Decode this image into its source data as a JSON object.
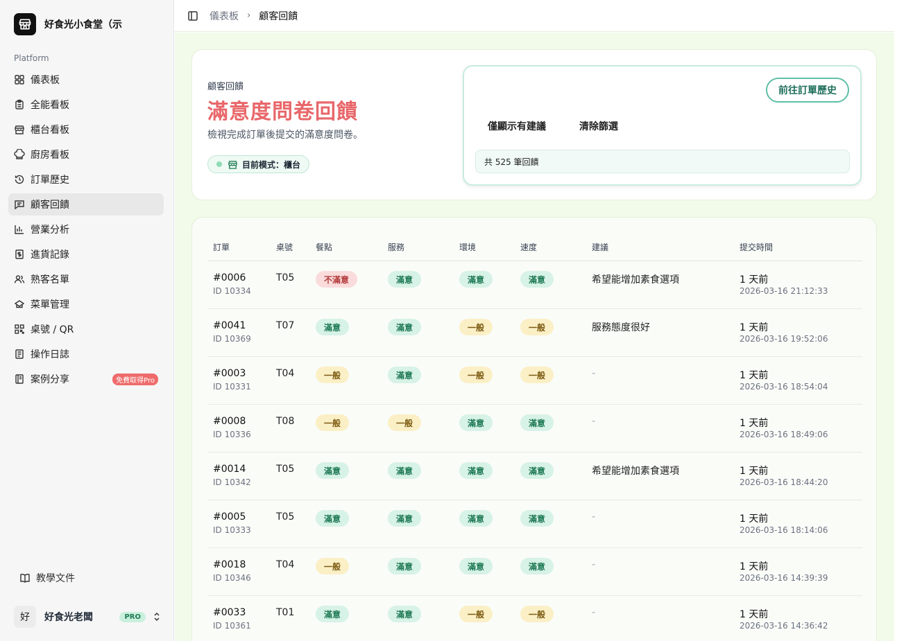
{
  "brand": {
    "name": "好食光小食堂（示"
  },
  "sidebar": {
    "group_label": "Platform",
    "items": [
      {
        "label": "儀表板",
        "icon": "grid-icon"
      },
      {
        "label": "全能看板",
        "icon": "clipboard-icon"
      },
      {
        "label": "櫃台看板",
        "icon": "store-icon"
      },
      {
        "label": "廚房看板",
        "icon": "chef-hat-icon"
      },
      {
        "label": "訂單歷史",
        "icon": "history-icon"
      },
      {
        "label": "顧客回饋",
        "icon": "message-icon",
        "active": true
      },
      {
        "label": "營業分析",
        "icon": "bar-chart-icon"
      },
      {
        "label": "進貨記錄",
        "icon": "receipt-icon"
      },
      {
        "label": "熟客名單",
        "icon": "users-icon"
      },
      {
        "label": "菜單管理",
        "icon": "menu-icon"
      },
      {
        "label": "桌號 / QR",
        "icon": "qr-icon"
      },
      {
        "label": "操作日誌",
        "icon": "log-icon"
      },
      {
        "label": "案例分享",
        "icon": "book-icon",
        "tag": "免費取得Pro"
      }
    ],
    "docs_label": "教學文件",
    "user": {
      "avatar": "好",
      "name": "好食光老闆",
      "badge": "PRO"
    }
  },
  "breadcrumb": {
    "parent": "儀表板",
    "current": "顧客回饋"
  },
  "hero": {
    "kicker": "顧客回饋",
    "title": "滿意度問卷回饋",
    "description": "檢視完成訂單後提交的滿意度問卷。",
    "mode": "目前模式：櫃台"
  },
  "filters": {
    "go_button": "前往訂單歷史",
    "only_suggestions": "僅顯示有建議",
    "clear": "清除篩選",
    "count_text": "共 525 筆回饋"
  },
  "table": {
    "headers": [
      "訂單",
      "桌號",
      "餐點",
      "服務",
      "環境",
      "速度",
      "建議",
      "提交時間"
    ],
    "rows": [
      {
        "order": "#0006",
        "id": "ID 10334",
        "table": "T05",
        "food": "不滿意",
        "service": "滿意",
        "env": "滿意",
        "speed": "滿意",
        "suggestion": "希望能增加素食選項",
        "ago": "1 天前",
        "time": "2026-03-16 21:12:33"
      },
      {
        "order": "#0041",
        "id": "ID 10369",
        "table": "T07",
        "food": "滿意",
        "service": "滿意",
        "env": "一般",
        "speed": "一般",
        "suggestion": "服務態度很好",
        "ago": "1 天前",
        "time": "2026-03-16 19:52:06"
      },
      {
        "order": "#0003",
        "id": "ID 10331",
        "table": "T04",
        "food": "一般",
        "service": "滿意",
        "env": "一般",
        "speed": "一般",
        "suggestion": "-",
        "ago": "1 天前",
        "time": "2026-03-16 18:54:04"
      },
      {
        "order": "#0008",
        "id": "ID 10336",
        "table": "T08",
        "food": "一般",
        "service": "一般",
        "env": "滿意",
        "speed": "滿意",
        "suggestion": "-",
        "ago": "1 天前",
        "time": "2026-03-16 18:49:06"
      },
      {
        "order": "#0014",
        "id": "ID 10342",
        "table": "T05",
        "food": "滿意",
        "service": "滿意",
        "env": "滿意",
        "speed": "滿意",
        "suggestion": "希望能增加素食選項",
        "ago": "1 天前",
        "time": "2026-03-16 18:44:20"
      },
      {
        "order": "#0005",
        "id": "ID 10333",
        "table": "T05",
        "food": "滿意",
        "service": "滿意",
        "env": "滿意",
        "speed": "滿意",
        "suggestion": "-",
        "ago": "1 天前",
        "time": "2026-03-16 18:14:06"
      },
      {
        "order": "#0018",
        "id": "ID 10346",
        "table": "T04",
        "food": "一般",
        "service": "滿意",
        "env": "滿意",
        "speed": "滿意",
        "suggestion": "-",
        "ago": "1 天前",
        "time": "2026-03-16 14:39:39"
      },
      {
        "order": "#0033",
        "id": "ID 10361",
        "table": "T01",
        "food": "滿意",
        "service": "滿意",
        "env": "一般",
        "speed": "一般",
        "suggestion": "-",
        "ago": "1 天前",
        "time": "2026-03-16 14:36:42"
      }
    ]
  },
  "colors": {
    "accent_title": "#e8676a",
    "good": "#d7f2e6",
    "ok": "#fbefc6",
    "bad": "#fadcdc",
    "page_bg": "#f2fbe9"
  }
}
